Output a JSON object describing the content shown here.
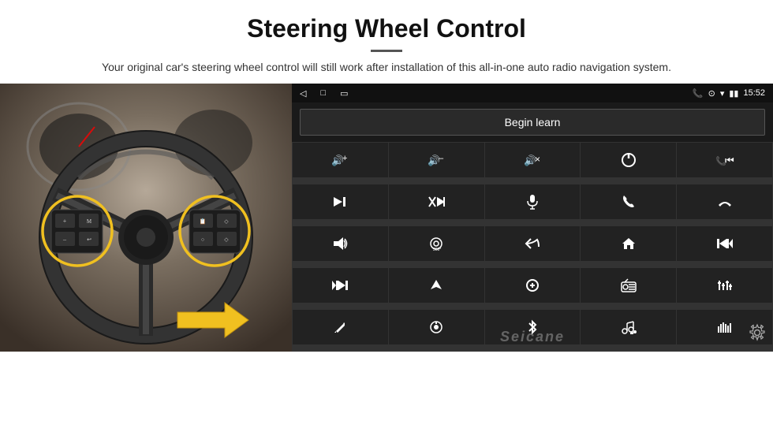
{
  "header": {
    "title": "Steering Wheel Control",
    "subtitle": "Your original car's steering wheel control will still work after installation of this all-in-one auto radio navigation system."
  },
  "status_bar": {
    "time": "15:52",
    "left_icons": [
      "◁",
      "□",
      "▭"
    ],
    "right_icons": [
      "📞",
      "⊙",
      "▾",
      "🔋"
    ]
  },
  "begin_learn_btn": "Begin learn",
  "controls": [
    [
      "🔊+",
      "🔊–",
      "🔊×",
      "⏻",
      "📞⏮"
    ],
    [
      "⏭|",
      "✕⏭",
      "🎤",
      "📞",
      "↩"
    ],
    [
      "📢",
      "360°",
      "↩",
      "⌂",
      "⏮⏮"
    ],
    [
      "⏭⏭",
      "▶",
      "⏏",
      "📻",
      "⚙"
    ],
    [
      "🎤",
      "⊙",
      "✱",
      "🎵",
      "|||"
    ]
  ],
  "watermark": "Seicane",
  "grid_icons": [
    {
      "row": 0,
      "icons": [
        "vol_up",
        "vol_down",
        "mute",
        "power",
        "phone_prev"
      ]
    },
    {
      "row": 1,
      "icons": [
        "next_track",
        "cross_next",
        "mic",
        "phone",
        "hang_up"
      ]
    },
    {
      "row": 2,
      "icons": [
        "horn",
        "cam360",
        "back",
        "home",
        "prev_prev"
      ]
    },
    {
      "row": 3,
      "icons": [
        "next_next",
        "nav",
        "eject",
        "radio",
        "eq"
      ]
    },
    {
      "row": 4,
      "icons": [
        "pen",
        "knob",
        "bluetooth",
        "music_settings",
        "levels"
      ]
    }
  ]
}
